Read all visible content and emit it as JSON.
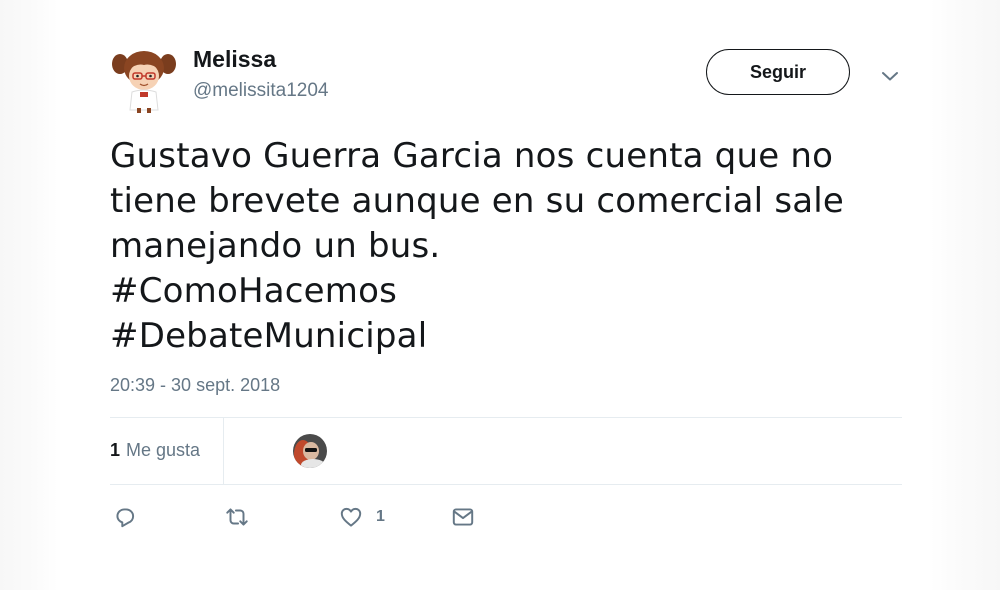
{
  "tweet": {
    "author": {
      "display_name": "Melissa",
      "handle": "@melissita1204",
      "avatar_icon": "cartoon-girl-avatar"
    },
    "follow_label": "Seguir",
    "text_lines": [
      "Gustavo Guerra Garcia nos cuenta que no",
      "tiene brevete aunque en su comercial sale",
      "manejando un bus.",
      "#ComoHacemos",
      "#DebateMunicipal"
    ],
    "timestamp": "20:39 - 30 sept. 2018",
    "likes": {
      "count": "1",
      "label": "Me gusta"
    },
    "actions": {
      "reply_icon": "reply-icon",
      "retweet_icon": "retweet-icon",
      "like_icon": "heart-icon",
      "like_count": "1",
      "dm_icon": "envelope-icon"
    }
  },
  "colors": {
    "text": "#14171a",
    "secondary": "#657786",
    "divider": "#e6ecf0"
  }
}
